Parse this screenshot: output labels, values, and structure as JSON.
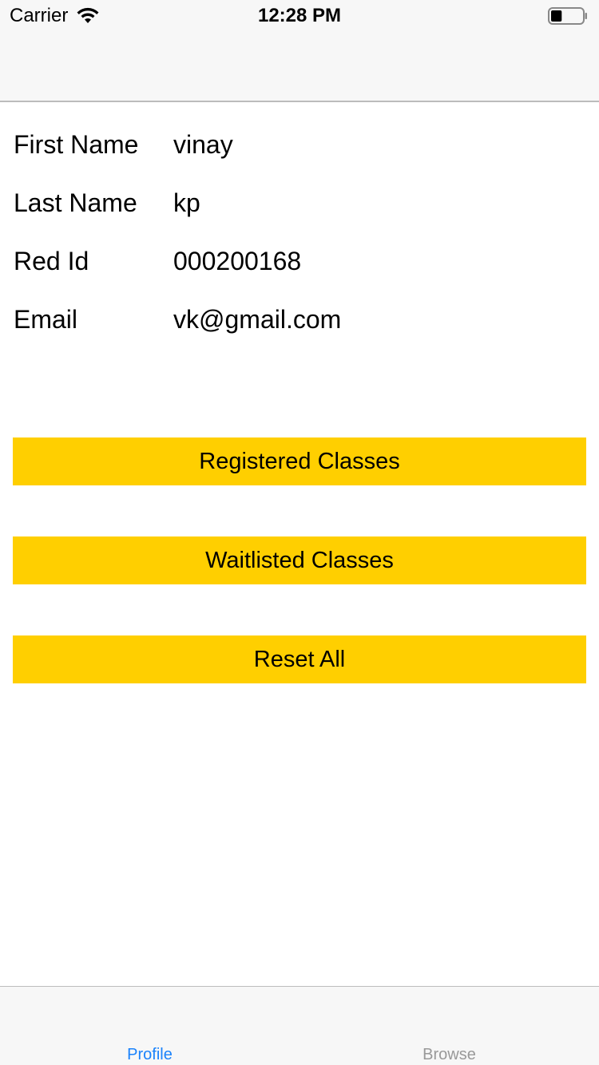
{
  "status_bar": {
    "carrier": "Carrier",
    "time": "12:28 PM",
    "wifi_icon": "wifi-icon",
    "battery_icon": "battery-icon",
    "battery_level": 0.35
  },
  "profile": {
    "rows": [
      {
        "label": "First Name",
        "value": "vinay"
      },
      {
        "label": "Last Name",
        "value": "kp"
      },
      {
        "label": "Red Id",
        "value": "000200168"
      },
      {
        "label": "Email",
        "value": "vk@gmail.com"
      }
    ]
  },
  "buttons": {
    "registered": "Registered Classes",
    "waitlisted": "Waitlisted Classes",
    "reset": "Reset All"
  },
  "tab_bar": {
    "tabs": [
      {
        "label": "Profile",
        "selected": true
      },
      {
        "label": "Browse",
        "selected": false
      }
    ]
  },
  "colors": {
    "accent": "#1a82fb",
    "button_bg": "#ffcf00",
    "inactive_tab": "#999999",
    "bar_bg": "#f7f7f7"
  }
}
